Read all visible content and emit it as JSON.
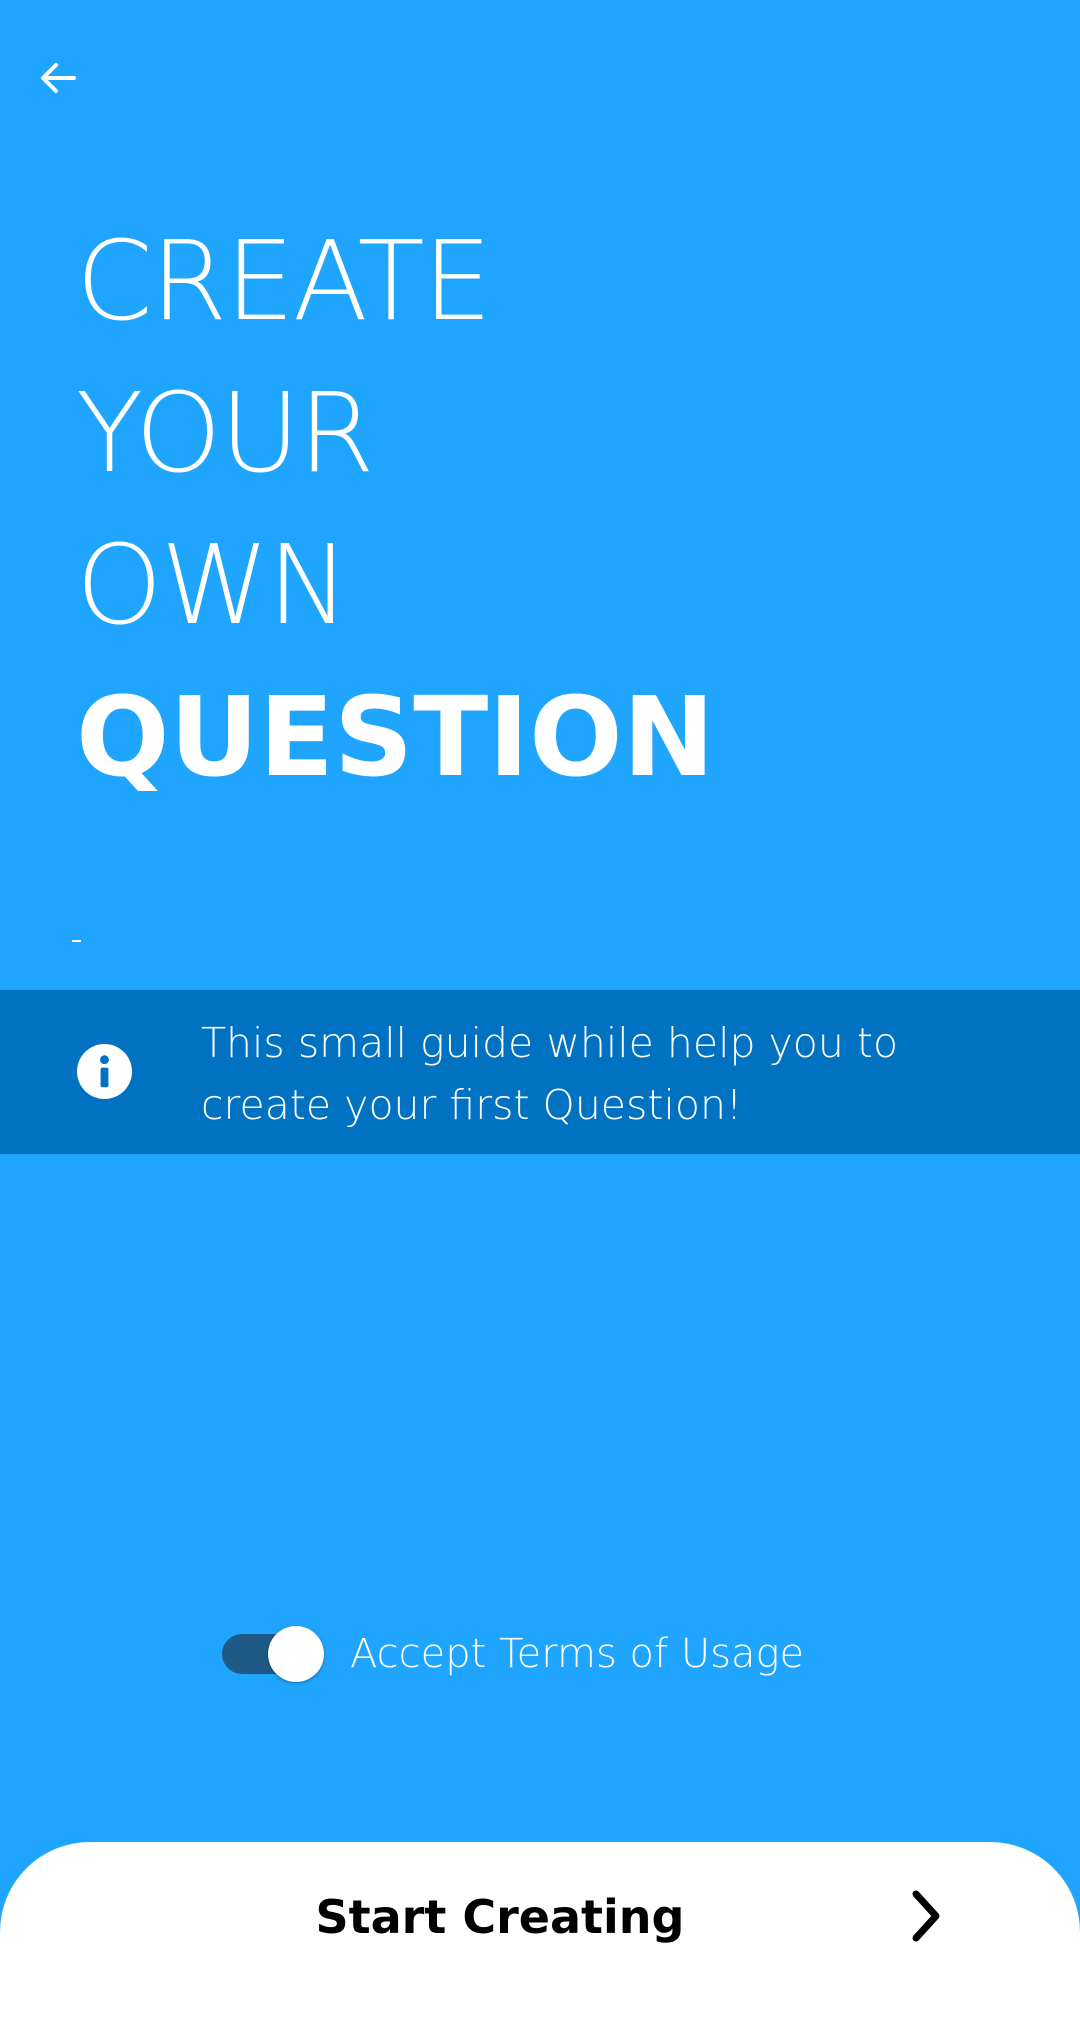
{
  "header": {
    "back_icon": "arrow-left-icon"
  },
  "title": {
    "line1": "CREATE",
    "line2": "YOUR",
    "line3": "OWN",
    "line4": "QUESTION"
  },
  "info_banner": {
    "icon": "info-icon",
    "text": "This small guide while help you to create your first Question!"
  },
  "terms": {
    "label": "Accept Terms of Usage",
    "checked": true
  },
  "cta": {
    "label": "Start Creating",
    "icon": "chevron-right-icon"
  },
  "colors": {
    "background": "#1fa5fe",
    "banner": "#0172c2",
    "toggle_track": "#1e5a85",
    "button": "#ffffff"
  }
}
